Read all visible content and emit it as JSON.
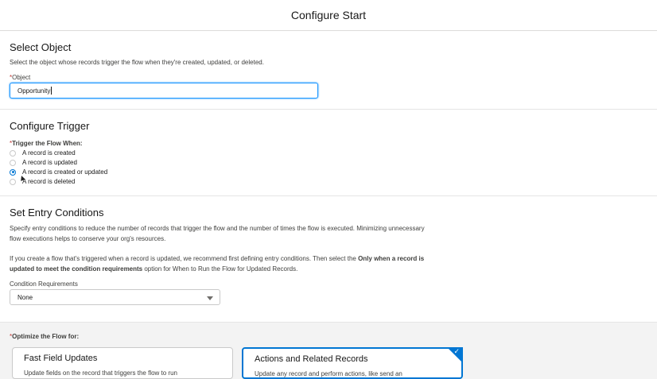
{
  "header": {
    "title": "Configure Start"
  },
  "select_object": {
    "title": "Select Object",
    "description": "Select the object whose records trigger the flow when they're created, updated, or deleted.",
    "field_label": "Object",
    "required_mark": "*",
    "value": "Opportunity"
  },
  "configure_trigger": {
    "title": "Configure Trigger",
    "required_mark": "*",
    "field_label": "Trigger the Flow When:",
    "options": [
      {
        "label": "A record is created",
        "checked": false
      },
      {
        "label": "A record is updated",
        "checked": false
      },
      {
        "label": "A record is created or updated",
        "checked": true
      },
      {
        "label": "A record is deleted",
        "checked": false
      }
    ]
  },
  "entry_conditions": {
    "title": "Set Entry Conditions",
    "para1_line1": "Specify entry conditions to reduce the number of records that trigger the flow and the number of times the flow is executed. Minimizing unnecessary",
    "para1_line2": "flow executions helps to conserve your org's resources.",
    "para2_line1_a": "If you create a flow that's triggered when a record is updated, we recommend first defining entry conditions. Then select the ",
    "para2_line1_b": "Only when a record is",
    "para2_line2_a": "updated to meet the condition requirements",
    "para2_line2_b": " option for When to Run the Flow for Updated Records.",
    "condition_label": "Condition Requirements",
    "condition_value": "None"
  },
  "optimize": {
    "required_mark": "*",
    "label": "Optimize the Flow for:",
    "cards": [
      {
        "title": "Fast Field Updates",
        "desc": "Update fields on the record that triggers the flow to run",
        "selected": false
      },
      {
        "title": "Actions and Related Records",
        "desc": "Update any record and perform actions, like send an",
        "selected": true
      }
    ]
  },
  "colors": {
    "accent": "#0176d3",
    "focus": "#1b96ff",
    "required": "#c23934"
  },
  "icons": {
    "select_chevron": "chevron-down-icon",
    "card_selected": "check-icon"
  }
}
